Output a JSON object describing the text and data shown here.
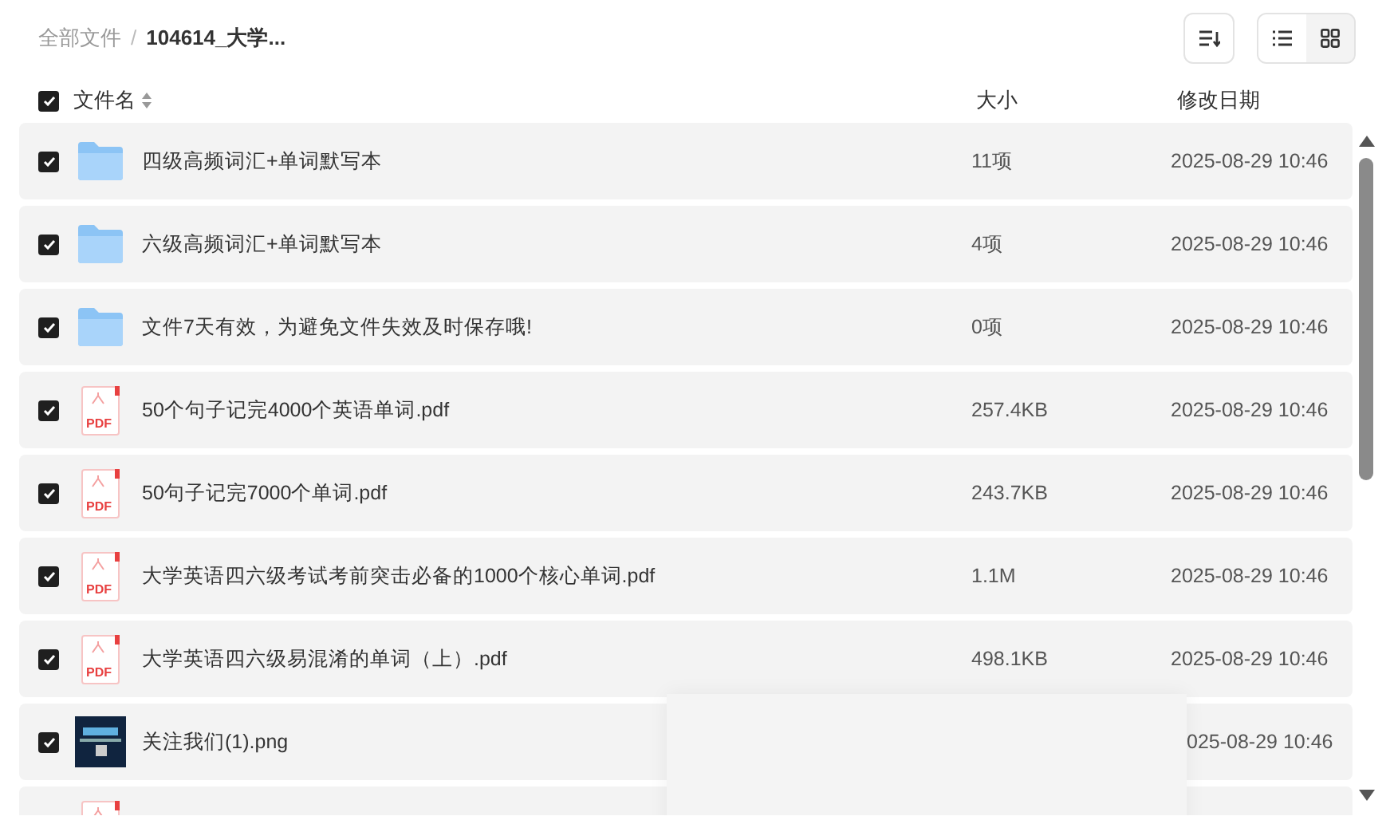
{
  "breadcrumb": [
    {
      "label": "全部文件",
      "current": false
    },
    {
      "label": "104614_大学...",
      "current": true
    }
  ],
  "breadcrumb_separator": "/",
  "view_toggle": [
    {
      "kind": "list",
      "selected": true
    },
    {
      "kind": "grid",
      "selected": false
    }
  ],
  "header": {
    "checked": true,
    "name": "文件名",
    "size": "大小",
    "date": "修改日期"
  },
  "rows": [
    {
      "kind": "folder",
      "checked": true,
      "name": "四级高频词汇+单词默写本",
      "size": "11项",
      "date": "2025-08-29 10:46"
    },
    {
      "kind": "folder",
      "checked": true,
      "name": "六级高频词汇+单词默写本",
      "size": "4项",
      "date": "2025-08-29 10:46"
    },
    {
      "kind": "folder",
      "checked": true,
      "name": "文件7天有效，为避免文件失效及时保存哦!",
      "size": "0项",
      "date": "2025-08-29 10:46"
    },
    {
      "kind": "pdf",
      "checked": true,
      "icon_label": "PDF",
      "name": "50个句子记完4000个英语单词.pdf",
      "size": "257.4KB",
      "date": "2025-08-29 10:46"
    },
    {
      "kind": "pdf",
      "checked": true,
      "icon_label": "PDF",
      "name": "50句子记完7000个单词.pdf",
      "size": "243.7KB",
      "date": "2025-08-29 10:46"
    },
    {
      "kind": "pdf",
      "checked": true,
      "icon_label": "PDF",
      "name": "大学英语四六级考试考前突击必备的1000个核心单词.pdf",
      "size": "1.1M",
      "date": "2025-08-29 10:46"
    },
    {
      "kind": "pdf",
      "checked": true,
      "icon_label": "PDF",
      "name": "大学英语四六级易混淆的单词（上）.pdf",
      "size": "498.1KB",
      "date": "2025-08-29 10:46"
    },
    {
      "kind": "image",
      "checked": true,
      "name": "关注我们(1).png",
      "date": "025-08-29 10:46",
      "overlay": true
    },
    {
      "kind": "pdf"
    }
  ]
}
